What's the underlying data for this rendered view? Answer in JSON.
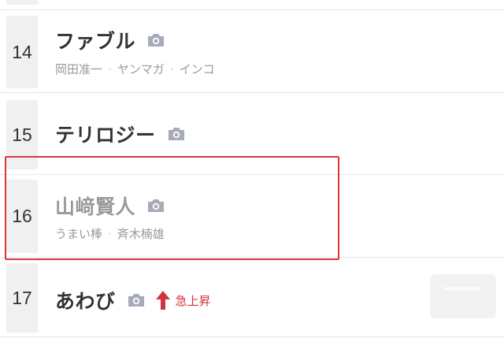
{
  "ranking": [
    {
      "rank": "14",
      "name": "ファブル",
      "tags": [
        "岡田准一",
        "ヤンマガ",
        "インコ"
      ],
      "dimmed": false
    },
    {
      "rank": "15",
      "name": "テリロジー",
      "tags": [],
      "dimmed": false
    },
    {
      "rank": "16",
      "name": "山﨑賢人",
      "tags": [
        "うまい棒",
        "斉木楠雄"
      ],
      "dimmed": true
    },
    {
      "rank": "17",
      "name": "あわび",
      "tags": [],
      "dimmed": false,
      "badge": "急上昇"
    }
  ],
  "colors": {
    "camera_icon": "#a7aab8",
    "surge": "#d2343a",
    "highlight_border": "#d93838",
    "rank_bg": "#f0f0f1"
  },
  "icons": {
    "camera": "camera-icon",
    "surge": "arrow-up-icon"
  }
}
